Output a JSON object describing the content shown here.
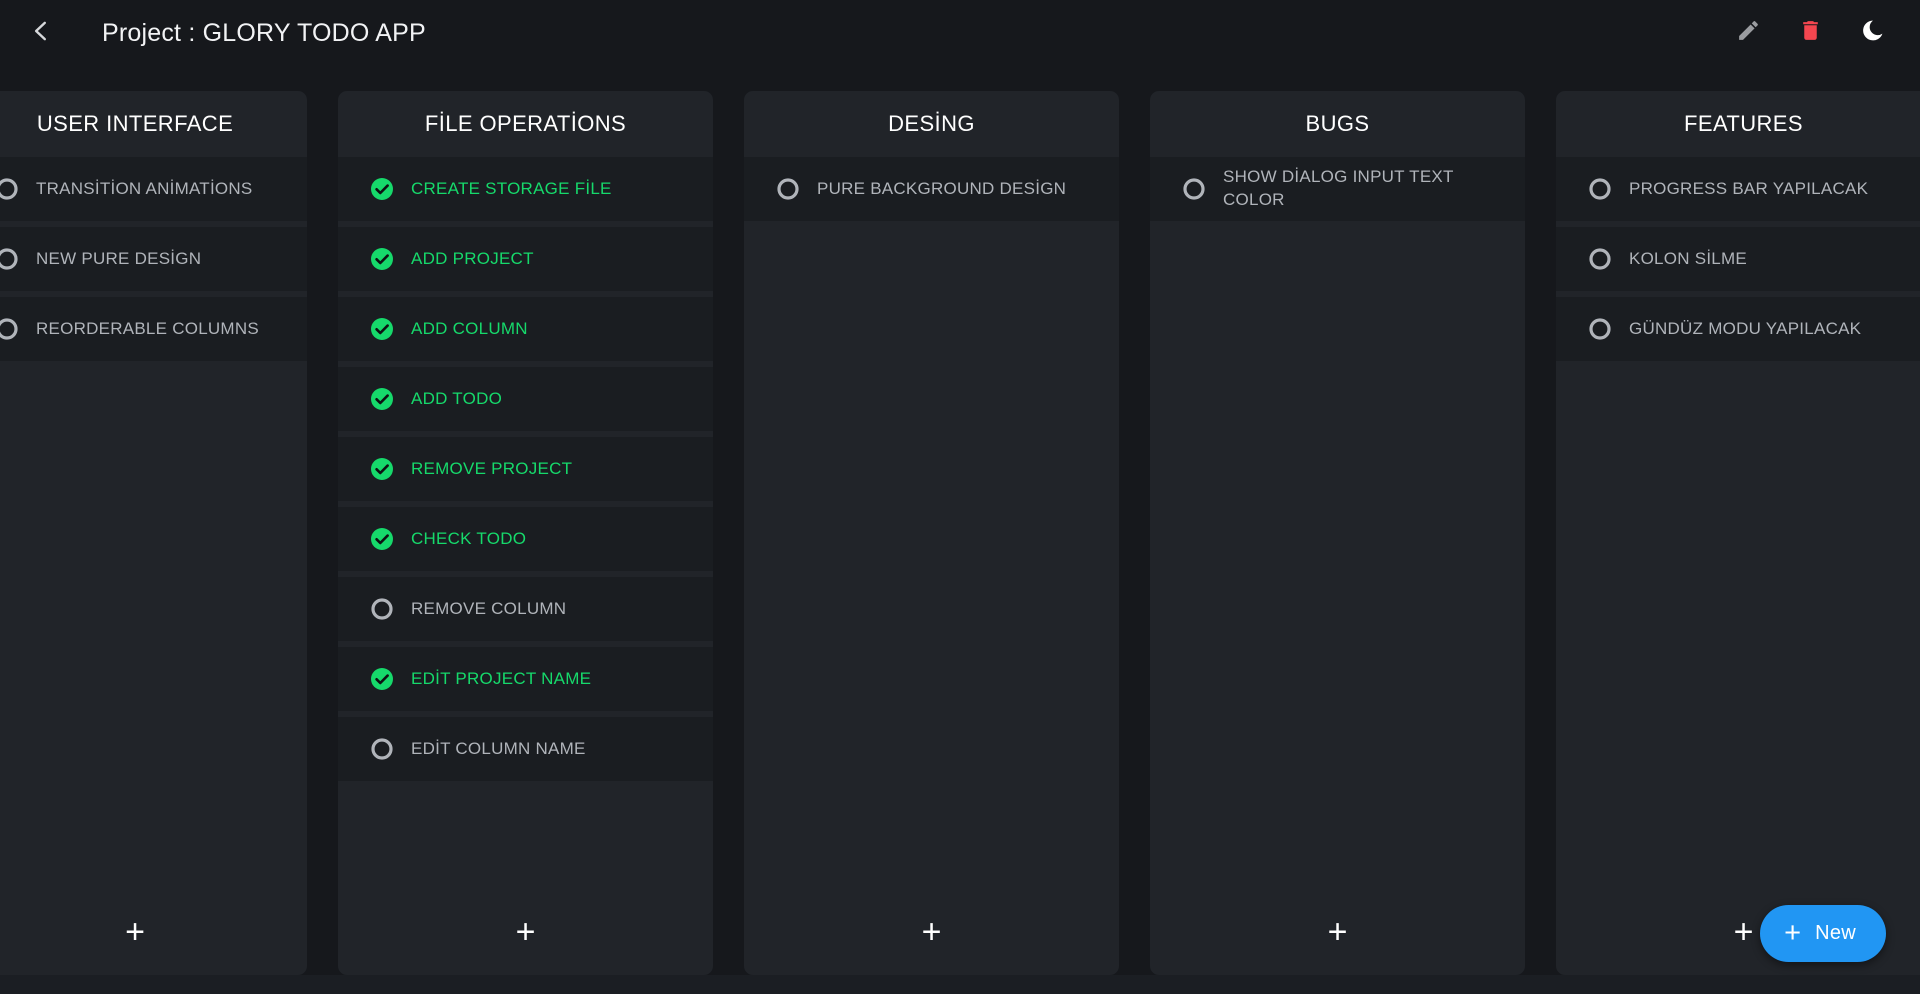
{
  "appbar": {
    "back_icon": "chevron-left-icon",
    "title": "Project : GLORY TODO APP",
    "actions": [
      {
        "name": "edit-project-button",
        "icon": "pencil-icon",
        "color": "#9a9ca0"
      },
      {
        "name": "delete-project-button",
        "icon": "trash-icon",
        "color": "#f4464f"
      },
      {
        "name": "theme-toggle-button",
        "icon": "moon-icon",
        "color": "#ffffff"
      }
    ]
  },
  "board": {
    "add_column_glyph": "+",
    "columns": [
      {
        "title": "USER INTERFACE",
        "clipped": true,
        "items": [
          {
            "label": "TRANSİTİON ANİMATİONS",
            "done": false
          },
          {
            "label": "NEW PURE DESİGN",
            "done": false
          },
          {
            "label": "REORDERABLE COLUMNS",
            "done": false
          }
        ]
      },
      {
        "title": "FİLE OPERATİONS",
        "clipped": false,
        "items": [
          {
            "label": "CREATE STORAGE FİLE",
            "done": true
          },
          {
            "label": "ADD PROJECT",
            "done": true
          },
          {
            "label": "ADD COLUMN",
            "done": true
          },
          {
            "label": "ADD TODO",
            "done": true
          },
          {
            "label": "REMOVE PROJECT",
            "done": true
          },
          {
            "label": "CHECK TODO",
            "done": true
          },
          {
            "label": "REMOVE COLUMN",
            "done": false
          },
          {
            "label": "EDİT PROJECT NAME",
            "done": true
          },
          {
            "label": "EDİT COLUMN NAME",
            "done": false
          }
        ]
      },
      {
        "title": "DESİNG",
        "clipped": false,
        "items": [
          {
            "label": "PURE BACKGROUND DESİGN",
            "done": false
          }
        ]
      },
      {
        "title": "BUGS",
        "clipped": false,
        "items": [
          {
            "label": "SHOW DİALOG INPUT TEXT COLOR",
            "done": false
          }
        ]
      },
      {
        "title": "FEATURES",
        "clipped": false,
        "items": [
          {
            "label": "PROGRESS BAR YAPILACAK",
            "done": false
          },
          {
            "label": "KOLON SİLME",
            "done": false
          },
          {
            "label": "GÜNDÜZ MODU YAPILACAK",
            "done": false
          }
        ]
      }
    ]
  },
  "fab": {
    "plus_glyph": "+",
    "label": "New"
  },
  "colors": {
    "page_background": "#16181c",
    "column_background": "#212429",
    "item_background": "#1a1d21",
    "done_accent": "#16d96b",
    "open_accent": "#b0b4ba",
    "fab_accent": "#2196f3",
    "delete_accent": "#f4464f"
  }
}
